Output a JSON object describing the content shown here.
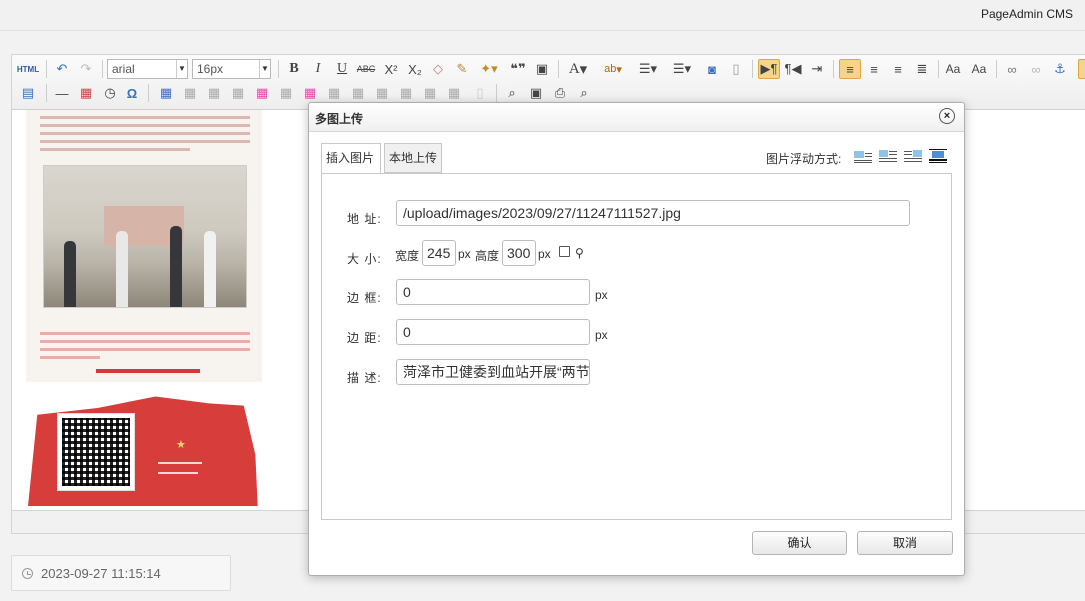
{
  "app": {
    "brand": "PageAdmin CMS"
  },
  "toolbar": {
    "html_label": "HTML",
    "font_family": "arial",
    "font_size": "16px",
    "bold": "B",
    "italic": "I",
    "underline": "U",
    "strike": "ABC",
    "superscript": "X²",
    "subscript": "X₂",
    "omega": "Ω",
    "quote": "❝❞",
    "font_color": "A",
    "highlight": "ab"
  },
  "dialog": {
    "title": "多图上传",
    "tabs": [
      {
        "label": "插入图片",
        "active": true
      },
      {
        "label": "本地上传",
        "active": false
      }
    ],
    "float_label": "图片浮动方式:",
    "fields": {
      "address": {
        "label": "地 址:",
        "value": "/upload/images/2023/09/27/11247111527.jpg"
      },
      "size": {
        "label": "大 小:",
        "width_label": "宽度",
        "width_value": "245",
        "height_label": "高度",
        "height_value": "300",
        "unit": "px"
      },
      "border": {
        "label": "边 框:",
        "value": "0",
        "unit": "px"
      },
      "margin": {
        "label": "边 距:",
        "value": "0",
        "unit": "px"
      },
      "description": {
        "label": "描 述:",
        "value": "菏泽市卫健委到血站开展“两节"
      }
    },
    "buttons": {
      "confirm": "确认",
      "cancel": "取消"
    }
  },
  "footer": {
    "datetime": "2023-09-27 11:15:14"
  }
}
